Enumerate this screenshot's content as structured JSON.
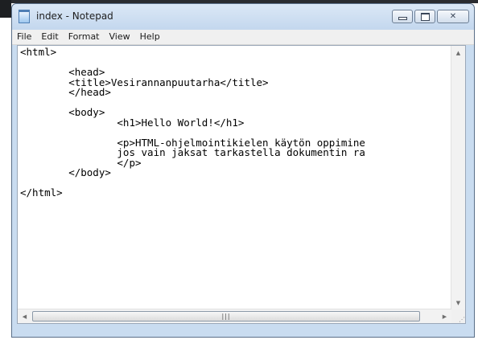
{
  "window": {
    "title": "index - Notepad"
  },
  "menu": [
    "File",
    "Edit",
    "Format",
    "View",
    "Help"
  ],
  "document": {
    "lines": [
      "<html>",
      "",
      "        <head>",
      "        <title>Vesirannanpuutarha</title>",
      "        </head>",
      "",
      "        <body>",
      "                <h1>Hello World!</h1>",
      "",
      "                <p>HTML-ohjelmointikielen käytön oppimine",
      "                jos vain jaksat tarkastella dokumentin ra",
      "                </p>",
      "        </body>",
      "",
      "</html>"
    ]
  },
  "icons": {
    "app": "notepad-icon",
    "minimize": "minimize-icon",
    "maximize": "maximize-icon",
    "close": "close-icon",
    "scroll_up": "scroll-up-arrow-icon",
    "scroll_down": "scroll-down-arrow-icon",
    "scroll_left": "scroll-left-arrow-icon",
    "scroll_right": "scroll-right-arrow-icon",
    "thumb_grip": "thumb-grip-icon",
    "size_grip": "size-grip-icon"
  },
  "colors": {
    "frame": "#c9dcf0",
    "close_button": "#d2deec"
  }
}
